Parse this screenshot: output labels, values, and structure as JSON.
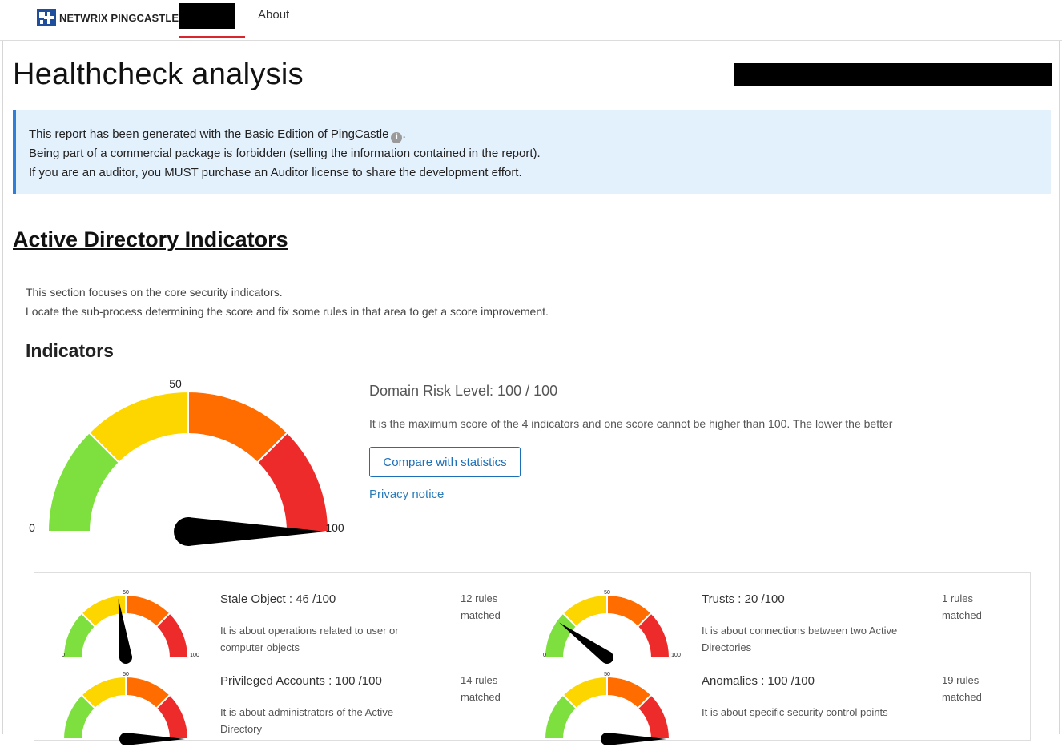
{
  "nav": {
    "brand": "NETWRIX PINGCASTLE",
    "about": "About"
  },
  "page": {
    "title": "Healthcheck analysis"
  },
  "notice": {
    "line1": "This report has been generated with the Basic Edition of PingCastle",
    "line1_end": ".",
    "line2": "Being part of a commercial package is forbidden (selling the information contained in the report).",
    "line3": "If you are an auditor, you MUST purchase an Auditor license to share the development effort."
  },
  "section": {
    "title": "Active Directory Indicators",
    "desc1": "This section focuses on the core security indicators.",
    "desc2": "Locate the sub-process determining the score and fix some rules in that area to get a score improvement.",
    "sub_title": "Indicators"
  },
  "main_gauge": {
    "value": 100,
    "label_min": "0",
    "label_mid": "50",
    "label_max": "100"
  },
  "risk": {
    "title": "Domain Risk Level: 100 / 100",
    "desc": "It is the maximum score of the 4 indicators and one score cannot be higher than 100. The lower the better",
    "compare_label": "Compare with statistics",
    "privacy_label": "Privacy notice"
  },
  "indicators": [
    {
      "title": "Stale Object : 46 /100",
      "desc": "It is about operations related to user or computer objects",
      "rules": "12 rules matched",
      "value": 46,
      "min": "0",
      "mid": "50",
      "max": "100"
    },
    {
      "title": "Trusts : 20 /100",
      "desc": "It is about connections between two Active Directories",
      "rules": "1 rules matched",
      "value": 20,
      "min": "0",
      "mid": "50",
      "max": "100"
    },
    {
      "title": "Privileged Accounts : 100 /100",
      "desc": "It is about administrators of the Active Directory",
      "rules": "14 rules matched",
      "value": 100,
      "mid": "50"
    },
    {
      "title": "Anomalies : 100 /100",
      "desc": "It is about specific security control points",
      "rules": "19 rules matched",
      "value": 100,
      "mid": "50"
    }
  ],
  "colors": {
    "green": "#7ee03e",
    "yellow": "#fdd600",
    "orange": "#ff6c00",
    "red": "#ee2b2b",
    "needle": "#000000",
    "accent_red": "#d9262c",
    "link_blue": "#1b6fb8"
  },
  "icons": {
    "brand": "pingcastle-logo-icon",
    "info": "info-icon"
  }
}
